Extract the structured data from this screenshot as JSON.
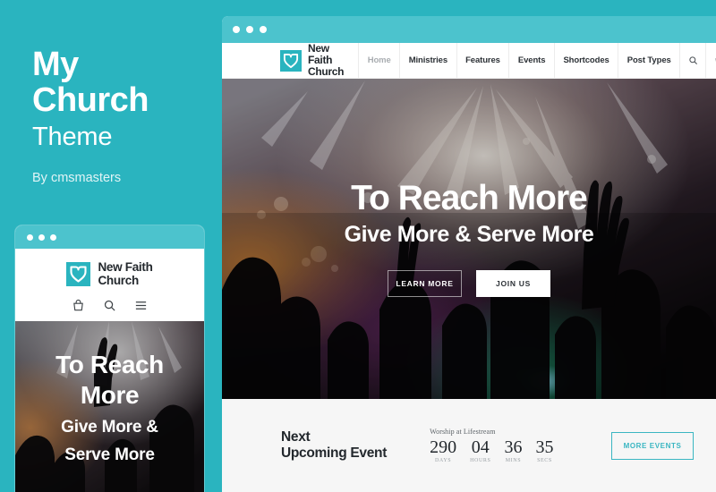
{
  "colors": {
    "accent": "#2ab4bf",
    "accent_light": "#4cc3cd",
    "text_dark": "#23282d",
    "text_muted": "#a9adb1",
    "panel_bg": "#f6f6f6"
  },
  "promo": {
    "title_line1": "My",
    "title_line2": "Church",
    "subtitle": "Theme",
    "byline": "By cmsmasters"
  },
  "brand": {
    "line1": "New Faith",
    "line2": "Church",
    "logo_icon": "heart-shield-icon"
  },
  "browser": {
    "window_dots": [
      "dot",
      "dot",
      "dot"
    ]
  },
  "nav": {
    "items": [
      {
        "label": "Home",
        "state": "muted"
      },
      {
        "label": "Ministries",
        "state": "active"
      },
      {
        "label": "Features",
        "state": "active"
      },
      {
        "label": "Events",
        "state": "active"
      },
      {
        "label": "Shortcodes",
        "state": "active"
      },
      {
        "label": "Post Types",
        "state": "active"
      }
    ],
    "icons": [
      {
        "name": "search-icon"
      },
      {
        "name": "cart-icon"
      }
    ]
  },
  "hero": {
    "headline": "To Reach More",
    "subheadline": "Give More & Serve More",
    "buttons": [
      {
        "label": "LEARN MORE",
        "style": "ghost"
      },
      {
        "label": "JOIN US",
        "style": "solid"
      }
    ]
  },
  "mobile": {
    "icons": [
      {
        "name": "cart-icon"
      },
      {
        "name": "search-icon"
      },
      {
        "name": "hamburger-menu-icon"
      }
    ],
    "hero": {
      "headline_line1": "To Reach",
      "headline_line2": "More",
      "subheadline_line1": "Give More &",
      "subheadline_line2": "Serve More"
    }
  },
  "event": {
    "title_line1": "Next",
    "title_line2": "Upcoming Event",
    "event_name": "Worship at Lifestream",
    "countdown": [
      {
        "value": "290",
        "unit": "DAYS"
      },
      {
        "value": "04",
        "unit": "HOURS"
      },
      {
        "value": "36",
        "unit": "MINS"
      },
      {
        "value": "35",
        "unit": "SECS"
      }
    ],
    "cta_label": "MORE EVENTS"
  }
}
